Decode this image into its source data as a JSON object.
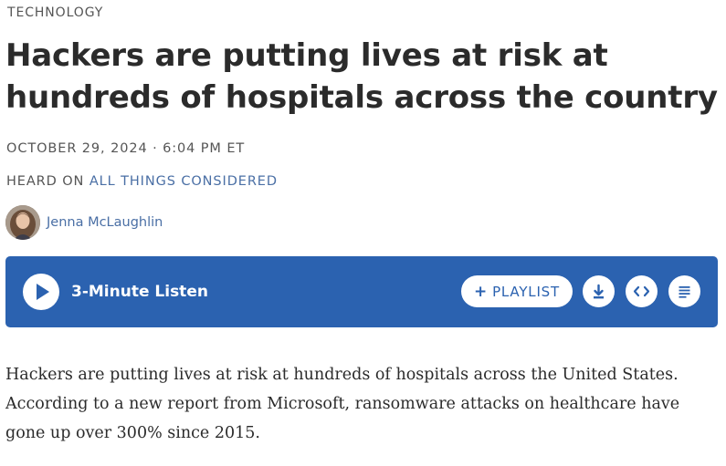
{
  "article": {
    "category": "TECHNOLOGY",
    "headline": "Hackers are putting lives at risk at hundreds of hospitals across the country",
    "dateline": "OCTOBER 29, 2024 · 6:04 PM ET",
    "heard_on_prefix": "HEARD ON ",
    "program": "ALL THINGS CONSIDERED",
    "author": "Jenna McLaughlin",
    "body": "Hackers are putting lives at risk at hundreds of hospitals across the United States. According to a new report from Microsoft, ransomware attacks on healthcare have gone up over 300% since 2015."
  },
  "player": {
    "listen_label": "3-Minute Listen",
    "playlist_plus": "+",
    "playlist_label": "PLAYLIST",
    "icons": [
      "play-icon",
      "download-icon",
      "embed-icon",
      "transcript-icon"
    ],
    "background_color": "#2b62b0"
  },
  "colors": {
    "link": "#4a6fa5",
    "text": "#2b2b2b",
    "meta": "#555555"
  }
}
